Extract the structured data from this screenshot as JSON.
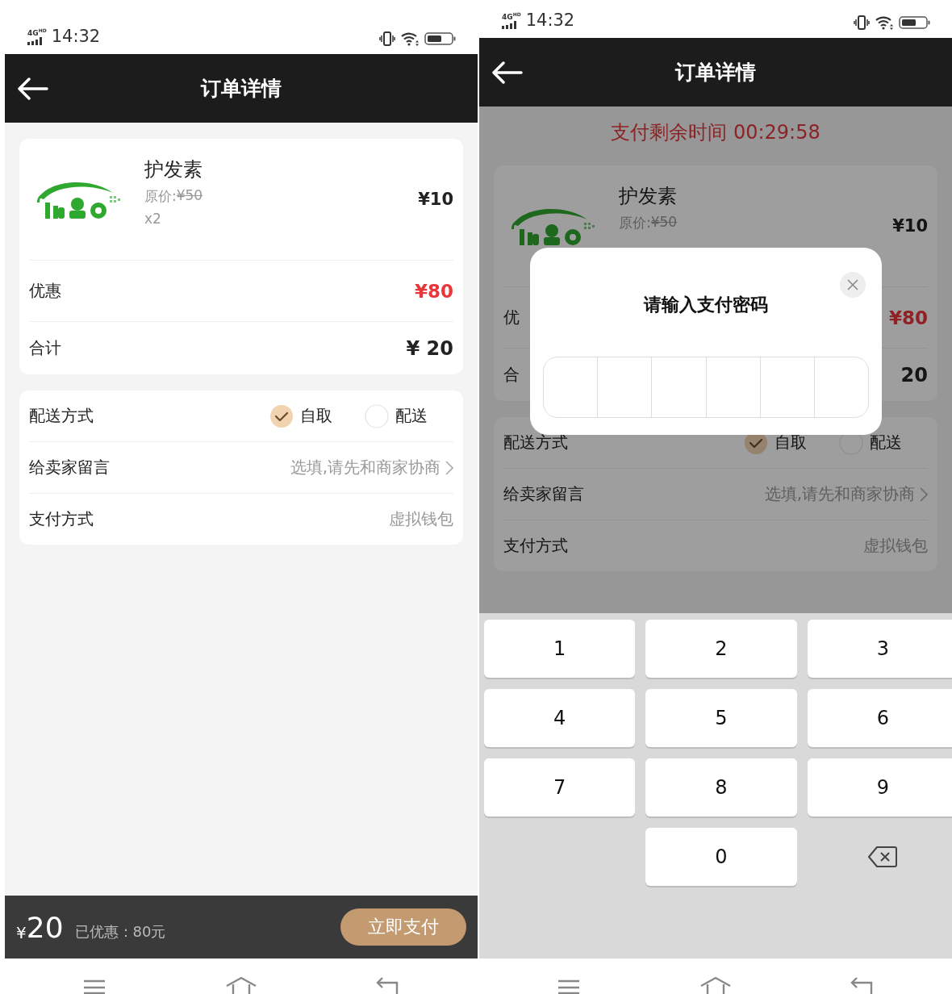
{
  "screens": [
    {
      "kind": "order",
      "status_bar": {
        "network": "4G",
        "network_badge": "HD",
        "time": "14:32"
      },
      "header": {
        "title": "订单详情"
      },
      "order": {
        "product": {
          "name": "护发素",
          "original_price_label": "原价:",
          "original_price": "¥50",
          "quantity": "x2",
          "price": "¥10"
        },
        "discount": {
          "label": "优惠",
          "value": "¥80"
        },
        "total": {
          "label": "合计",
          "value": "¥ 20"
        }
      },
      "options": {
        "delivery": {
          "label": "配送方式",
          "choices": [
            {
              "label": "自取",
              "selected": true
            },
            {
              "label": "配送",
              "selected": false
            }
          ]
        },
        "message": {
          "label": "给卖家留言",
          "value": "选填,请先和商家协商"
        },
        "payment": {
          "label": "支付方式",
          "value": "虚拟钱包"
        }
      },
      "footer": {
        "currency": "¥",
        "amount": "20",
        "saved": "已优惠：80元",
        "pay_button": "立即支付"
      }
    },
    {
      "kind": "password",
      "status_bar": {
        "network": "4G",
        "network_badge": "HD",
        "time": "14:32"
      },
      "header": {
        "title": "订单详情"
      },
      "timer": "支付剩余时间 00:29:58",
      "order": {
        "product": {
          "name": "护发素",
          "original_price_label": "原价:",
          "original_price": "¥50",
          "price": "¥10"
        },
        "discount": {
          "label": "优",
          "value": "¥80"
        },
        "total": {
          "label": "合",
          "value": "20"
        }
      },
      "options": {
        "delivery": {
          "label": "配送方式",
          "choices": [
            {
              "label": "自取",
              "selected": true
            },
            {
              "label": "配送",
              "selected": false
            }
          ]
        },
        "message": {
          "label": "给卖家留言",
          "value": "选填,请先和商家协商"
        },
        "payment": {
          "label": "支付方式",
          "value": "虚拟钱包"
        }
      },
      "modal": {
        "title": "请输入支付密码"
      },
      "keypad": {
        "keys": [
          "1",
          "2",
          "3",
          "4",
          "5",
          "6",
          "7",
          "8",
          "9",
          "0"
        ]
      }
    }
  ]
}
